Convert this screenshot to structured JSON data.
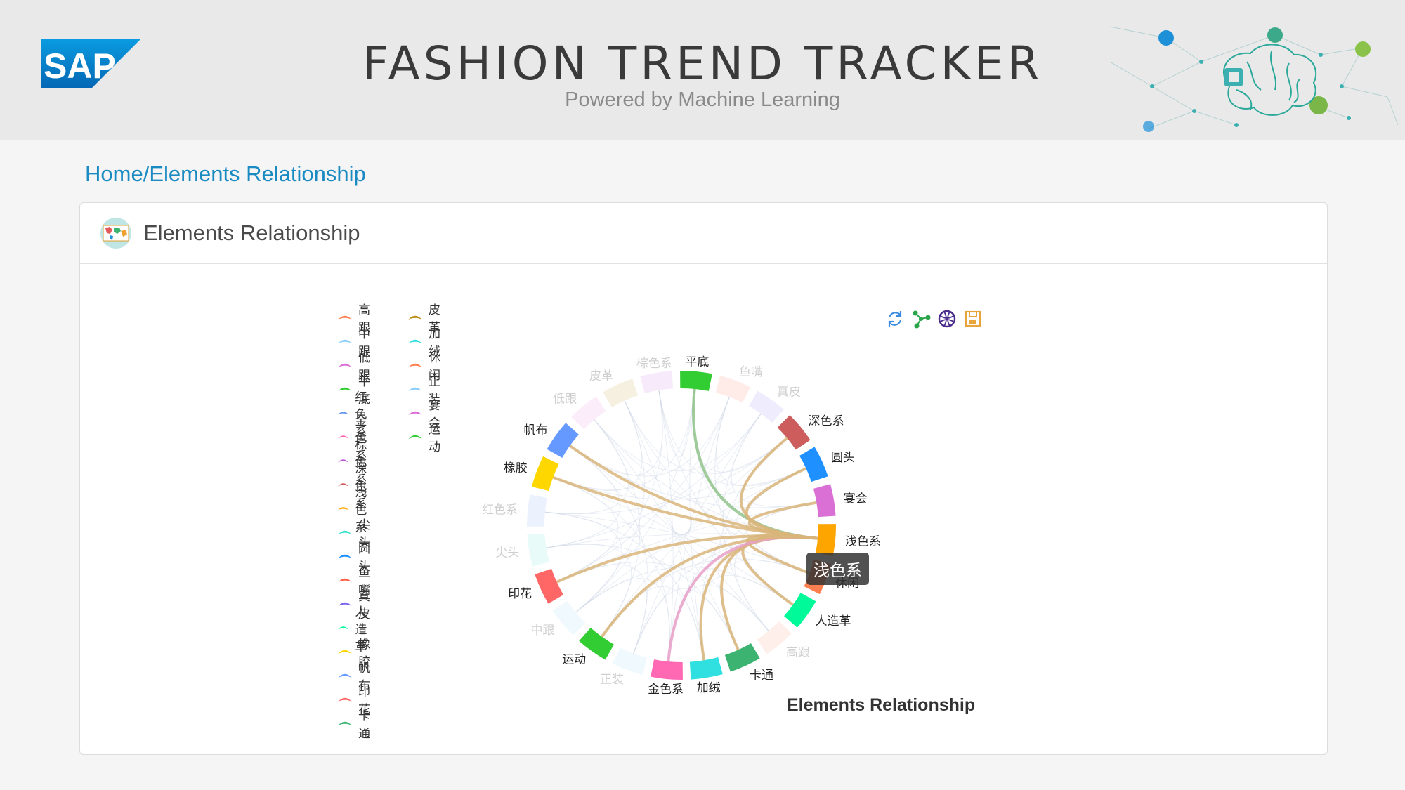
{
  "header": {
    "logo_text": "SAP",
    "title": "FASHION TREND TRACKER",
    "subtitle": "Powered by Machine Learning"
  },
  "breadcrumb": {
    "home": "Home",
    "separator": "/",
    "current": "Elements Relationship"
  },
  "panel": {
    "title": "Elements Relationship",
    "icon": "world-map-icon"
  },
  "toolbox": [
    {
      "name": "restore-icon",
      "color": "#3b8be0"
    },
    {
      "name": "data-view-icon",
      "color": "#2aa54a"
    },
    {
      "name": "chart-type-icon",
      "color": "#4a2b8c"
    },
    {
      "name": "save-image-icon",
      "color": "#e8a53c"
    }
  ],
  "tooltip": "浅色系",
  "chart_data": {
    "type": "chord",
    "title": "Elements Relationship",
    "legend_position": "left",
    "legend": [
      {
        "name": "高跟",
        "color": "#ff7f50"
      },
      {
        "name": "中跟",
        "color": "#87cefa"
      },
      {
        "name": "低跟",
        "color": "#da70d6"
      },
      {
        "name": "平底",
        "color": "#32cd32"
      },
      {
        "name": "红色系",
        "color": "#6495ed"
      },
      {
        "name": "金色系",
        "color": "#ff69b4"
      },
      {
        "name": "棕色系",
        "color": "#ba55d3"
      },
      {
        "name": "深色系",
        "color": "#cd5c5c"
      },
      {
        "name": "浅色系",
        "color": "#ffa500"
      },
      {
        "name": "尖头",
        "color": "#40e0d0"
      },
      {
        "name": "圆头",
        "color": "#1e90ff"
      },
      {
        "name": "鱼嘴",
        "color": "#ff6347"
      },
      {
        "name": "真皮",
        "color": "#7b68ee"
      },
      {
        "name": "人造革",
        "color": "#00fa9a"
      },
      {
        "name": "橡胶",
        "color": "#ffd700"
      },
      {
        "name": "帆布",
        "color": "#6699ff"
      },
      {
        "name": "印花",
        "color": "#ff6666"
      },
      {
        "name": "卡通",
        "color": "#3cb371"
      },
      {
        "name": "皮革",
        "color": "#b8860b"
      },
      {
        "name": "加绒",
        "color": "#30e0e0"
      },
      {
        "name": "休闲",
        "color": "#ff7f50"
      },
      {
        "name": "正装",
        "color": "#87cefa"
      },
      {
        "name": "宴会",
        "color": "#da70d6"
      },
      {
        "name": "运动",
        "color": "#32cd32"
      }
    ],
    "nodes": [
      {
        "name": "平底",
        "color": "#32cd32",
        "active": true
      },
      {
        "name": "鱼嘴",
        "color": "#ff6347",
        "active": false
      },
      {
        "name": "真皮",
        "color": "#7b68ee",
        "active": false
      },
      {
        "name": "深色系",
        "color": "#cd5c5c",
        "active": true
      },
      {
        "name": "圆头",
        "color": "#1e90ff",
        "active": true
      },
      {
        "name": "宴会",
        "color": "#da70d6",
        "active": true
      },
      {
        "name": "浅色系",
        "color": "#ffa500",
        "active": true
      },
      {
        "name": "休闲",
        "color": "#ff7f50",
        "active": true
      },
      {
        "name": "人造革",
        "color": "#00fa9a",
        "active": true
      },
      {
        "name": "高跟",
        "color": "#ff7f50",
        "active": false
      },
      {
        "name": "卡通",
        "color": "#3cb371",
        "active": true
      },
      {
        "name": "加绒",
        "color": "#30e0e0",
        "active": true
      },
      {
        "name": "金色系",
        "color": "#ff69b4",
        "active": true
      },
      {
        "name": "正装",
        "color": "#87cefa",
        "active": false
      },
      {
        "name": "运动",
        "color": "#32cd32",
        "active": true
      },
      {
        "name": "中跟",
        "color": "#87cefa",
        "active": false
      },
      {
        "name": "印花",
        "color": "#ff6666",
        "active": true
      },
      {
        "name": "尖头",
        "color": "#40e0d0",
        "active": false
      },
      {
        "name": "红色系",
        "color": "#6495ed",
        "active": false
      },
      {
        "name": "橡胶",
        "color": "#ffd700",
        "active": true
      },
      {
        "name": "帆布",
        "color": "#6699ff",
        "active": true
      },
      {
        "name": "低跟",
        "color": "#da70d6",
        "active": false
      },
      {
        "name": "皮革",
        "color": "#b8860b",
        "active": false
      },
      {
        "name": "棕色系",
        "color": "#ba55d3",
        "active": false
      }
    ],
    "highlight_links": [
      [
        "浅色系",
        "平底"
      ],
      [
        "浅色系",
        "深色系"
      ],
      [
        "浅色系",
        "圆头"
      ],
      [
        "浅色系",
        "宴会"
      ],
      [
        "浅色系",
        "休闲"
      ],
      [
        "浅色系",
        "人造革"
      ],
      [
        "浅色系",
        "卡通"
      ],
      [
        "浅色系",
        "加绒"
      ],
      [
        "浅色系",
        "金色系"
      ],
      [
        "浅色系",
        "运动"
      ],
      [
        "浅色系",
        "印花"
      ],
      [
        "浅色系",
        "橡胶"
      ],
      [
        "浅色系",
        "帆布"
      ]
    ]
  }
}
